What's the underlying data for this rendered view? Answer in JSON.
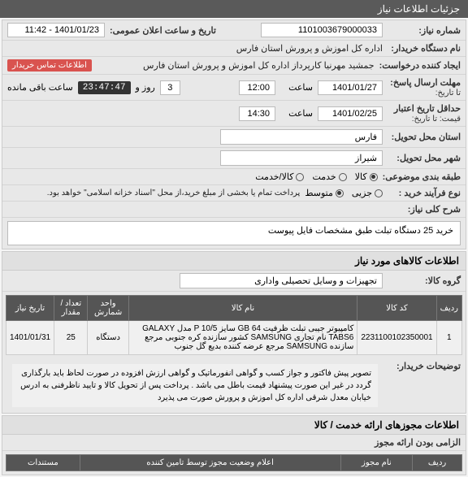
{
  "header": {
    "title": "جزئیات اطلاعات نیاز"
  },
  "fields": {
    "req_no_label": "شماره نیاز:",
    "req_no": "1101003679000033",
    "pub_date_label": "تاریخ و ساعت اعلان عمومی:",
    "pub_date": "1401/01/23 - 11:42",
    "buyer_org_label": "نام دستگاه خریدار:",
    "buyer_org": "اداره کل اموزش و پرورش استان فارس",
    "creator_label": "ایجاد کننده درخواست:",
    "creator": "جمشید مهرنیا کارپرداز اداره کل اموزش و پرورش استان فارس",
    "contact_btn": "اطلاعات تماس خریدار",
    "deadline_label": "مهلت ارسال پاسخ:",
    "deadline_to_label": "تا تاریخ:",
    "deadline_date": "1401/01/27",
    "time_label": "ساعت",
    "deadline_time": "12:00",
    "days_label": "روز و",
    "days": "3",
    "countdown": "23:47:47",
    "remain_label": "ساعت باقی مانده",
    "validity_label": "حداقل تاریخ اعتبار",
    "validity_sub": "قیمت: تا تاریخ:",
    "validity_date": "1401/02/25",
    "validity_time": "14:30",
    "province_label": "استان محل تحویل:",
    "province": "فارس",
    "city_label": "شهر محل تحویل:",
    "city": "شیراز",
    "class_label": "طبقه بندی موضوعی:",
    "class_goods": "کالا",
    "class_service": "خدمت",
    "class_goods_service": "کالا/خدمت",
    "process_label": "نوع فرآیند خرید :",
    "proc_small": "جزیی",
    "proc_medium": "متوسط",
    "proc_note": "پرداخت تمام یا بخشی از مبلغ خرید،از محل \"اسناد خزانه اسلامی\" خواهد بود.",
    "desc_label": "شرح کلی نیاز:",
    "desc": "خرید 25 دستگاه تبلت طبق مشخصات فایل پیوست"
  },
  "goods_section_title": "اطلاعات کالاهای مورد نیاز",
  "group_label": "گروه کالا:",
  "group_value": "تجهیزات و وسایل تحصیلی واداری",
  "table": {
    "headers": {
      "row": "ردیف",
      "code": "کد کالا",
      "name": "نام کالا",
      "unit": "واحد شمارش",
      "qty": "تعداد / مقدار",
      "date": "تاریخ نیاز"
    },
    "rows": [
      {
        "row": "1",
        "code": "2231100102350001",
        "name": "کامپیوتر جیبی تبلت ظرفیت GB 64 سایز P 10/5 مدل GALAXY TABS6 نام تجاری SAMSUNG کشور سازنده کره جنوبی مرجع سازنده SAMSUNG مرجع عرضه کننده بدیع گل جنوب",
        "unit": "دستگاه",
        "qty": "25",
        "date": "1401/01/31"
      }
    ]
  },
  "buyer_note_label": "توضیحات خریدار:",
  "buyer_note": "تصویر پیش فاکتور و جواز کسب و گواهی انفورماتیک و گواهی ارزش افزوده در صورت لحاظ باید بارگذاری گردد در غیر این صورت پیشنهاد قیمت باطل می باشد . پرداخت پس از تحویل کالا و تایید ناظرفنی به ادرس خیابان معدل شرقی اداره کل اموزش و پرورش صورت می پذیرد",
  "license_section_title": "اطلاعات مجوزهای ارائه خدمت / کالا",
  "license_label": "الزامی بودن ارائه مجوز",
  "cols": {
    "row": "ردیف",
    "license_name": "نام مجوز",
    "supplier_status": "اعلام وضعیت مجوز توسط تامین کننده",
    "document": "مستندات"
  }
}
